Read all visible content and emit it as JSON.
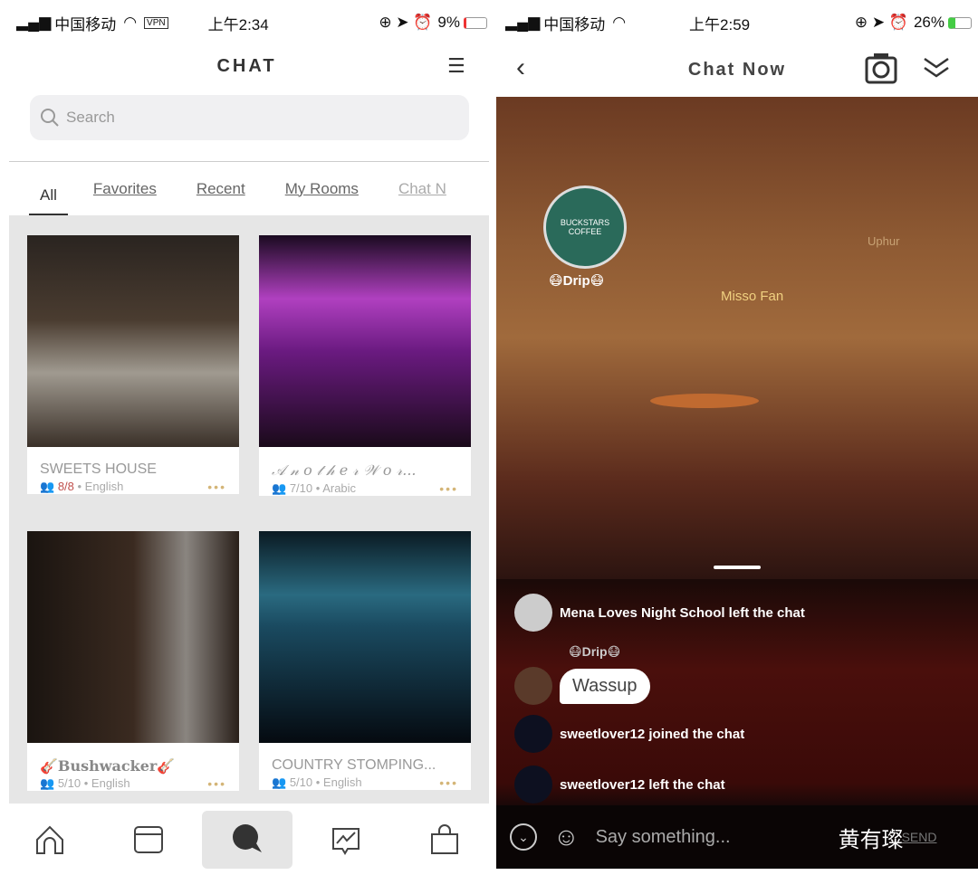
{
  "left": {
    "status": {
      "carrier": "中国移动",
      "vpn": "VPN",
      "time": "上午2:34",
      "battery": "9%"
    },
    "header": {
      "title": "CHAT"
    },
    "search": {
      "placeholder": "Search"
    },
    "tabs": [
      {
        "label": "All",
        "active": true
      },
      {
        "label": "Favorites"
      },
      {
        "label": "Recent"
      },
      {
        "label": "My Rooms"
      },
      {
        "label": "Chat N"
      }
    ],
    "rooms": [
      {
        "name": "SWEETS  HOUSE",
        "occupancy": "8/8",
        "full": true,
        "language": "• English"
      },
      {
        "name": "𝒜 𝓃 𝑜 𝓉 𝒽 𝑒 𝓇 𝒲 𝑜 𝓇...",
        "occupancy": "7/10",
        "language": "• Arabic"
      },
      {
        "name": "🎸Bushwacker🎸",
        "occupancy": "5/10",
        "language": "• English"
      },
      {
        "name": "COUNTRY STOMPING...",
        "occupancy": "5/10",
        "language": "• English"
      }
    ],
    "more": "•••",
    "nav": [
      {
        "icon": "home-icon"
      },
      {
        "icon": "feed-icon"
      },
      {
        "icon": "chat-icon",
        "active": true
      },
      {
        "icon": "activity-icon"
      },
      {
        "icon": "shop-icon"
      }
    ]
  },
  "right": {
    "status": {
      "carrier": "中国移动",
      "time": "上午2:59",
      "battery": "26%"
    },
    "header": {
      "title": "Chat Now"
    },
    "scene": {
      "sign": "BUCKSTARS COFFEE",
      "labels": [
        "😷Drip😷",
        "Misso Fan",
        "Uphur"
      ]
    },
    "messages": [
      {
        "text": "Mena Loves Night School left the chat"
      },
      {
        "sender": "😷Drip😷",
        "text": "Wassup"
      },
      {
        "text": "sweetlover12 joined the chat"
      },
      {
        "text": "sweetlover12 left the chat"
      }
    ],
    "input": {
      "placeholder": "Say something...",
      "send": "SEND"
    },
    "watermark": "黄有璨"
  },
  "colors": {
    "accent": "#d4b577",
    "full": "#c0504d"
  }
}
